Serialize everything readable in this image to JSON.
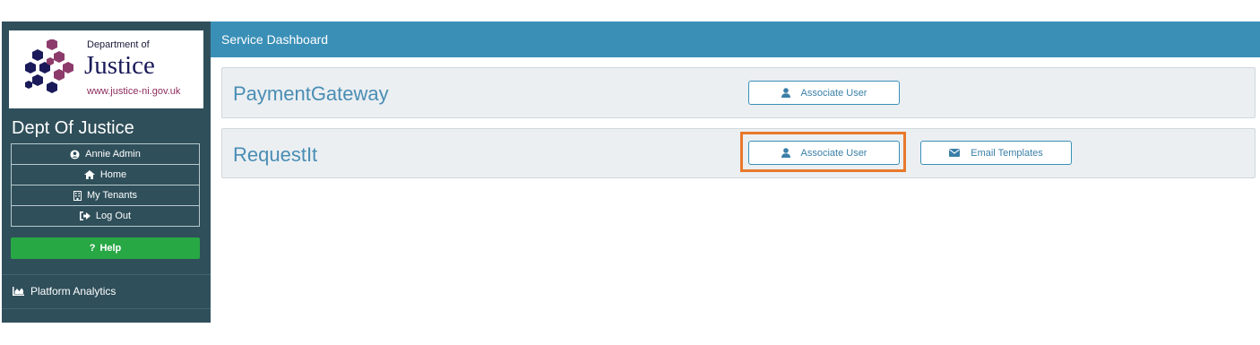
{
  "sidebar": {
    "logo": {
      "department_of": "Department of",
      "justice": "Justice",
      "url": "www.justice-ni.gov.uk"
    },
    "org_name": "Dept Of Justice",
    "menu": [
      {
        "label": "Annie Admin",
        "icon": "user-circle-icon"
      },
      {
        "label": "Home",
        "icon": "home-icon"
      },
      {
        "label": "My Tenants",
        "icon": "building-icon"
      },
      {
        "label": "Log Out",
        "icon": "logout-icon"
      }
    ],
    "help_label": "Help",
    "help_color": "#28a745",
    "analytics_label": "Platform Analytics",
    "background_color": "#2f4f5a"
  },
  "header": {
    "title": "Service Dashboard",
    "color": "#3a8fb7"
  },
  "services": [
    {
      "name": "PaymentGateway",
      "buttons": [
        {
          "label": "Associate User",
          "icon": "user-icon"
        }
      ]
    },
    {
      "name": "RequestIt",
      "buttons": [
        {
          "label": "Associate User",
          "icon": "user-icon",
          "highlighted": true
        },
        {
          "label": "Email Templates",
          "icon": "envelope-icon"
        }
      ]
    }
  ],
  "highlight_color": "#e8782a"
}
